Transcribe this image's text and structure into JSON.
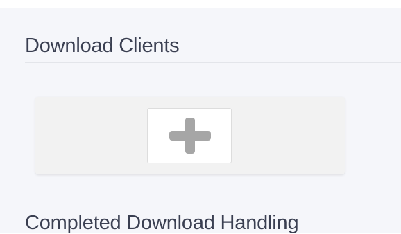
{
  "sections": {
    "download_clients": {
      "title": "Download Clients"
    },
    "completed_handling": {
      "title": "Completed Download Handling"
    }
  },
  "icons": {
    "add": "plus-icon"
  },
  "colors": {
    "background": "#f5f6fa",
    "card": "#f2f2f2",
    "plus": "#a6a6a6",
    "title": "#3a3f51"
  }
}
